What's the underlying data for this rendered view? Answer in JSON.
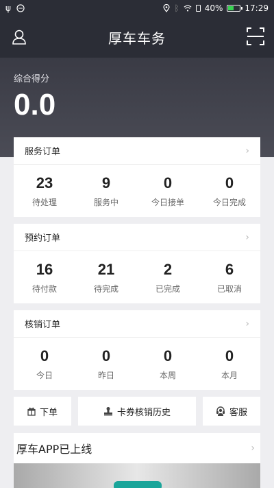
{
  "status_bar": {
    "battery": "40%",
    "time": "17:29"
  },
  "header": {
    "title": "厚车车务"
  },
  "score": {
    "label": "综合得分",
    "value": "0.0"
  },
  "cards": [
    {
      "title": "服务订单",
      "stats": [
        {
          "num": "23",
          "label": "待处理"
        },
        {
          "num": "9",
          "label": "服务中"
        },
        {
          "num": "0",
          "label": "今日接单"
        },
        {
          "num": "0",
          "label": "今日完成"
        }
      ]
    },
    {
      "title": "预约订单",
      "stats": [
        {
          "num": "16",
          "label": "待付款"
        },
        {
          "num": "21",
          "label": "待完成"
        },
        {
          "num": "2",
          "label": "已完成"
        },
        {
          "num": "6",
          "label": "已取消"
        }
      ]
    },
    {
      "title": "核销订单",
      "stats": [
        {
          "num": "0",
          "label": "今日"
        },
        {
          "num": "0",
          "label": "昨日"
        },
        {
          "num": "0",
          "label": "本周"
        },
        {
          "num": "0",
          "label": "本月"
        }
      ]
    }
  ],
  "actions": {
    "order": "下单",
    "history": "卡券核销历史",
    "service": "客服"
  },
  "promo": {
    "title": "厚车APP已上线"
  }
}
